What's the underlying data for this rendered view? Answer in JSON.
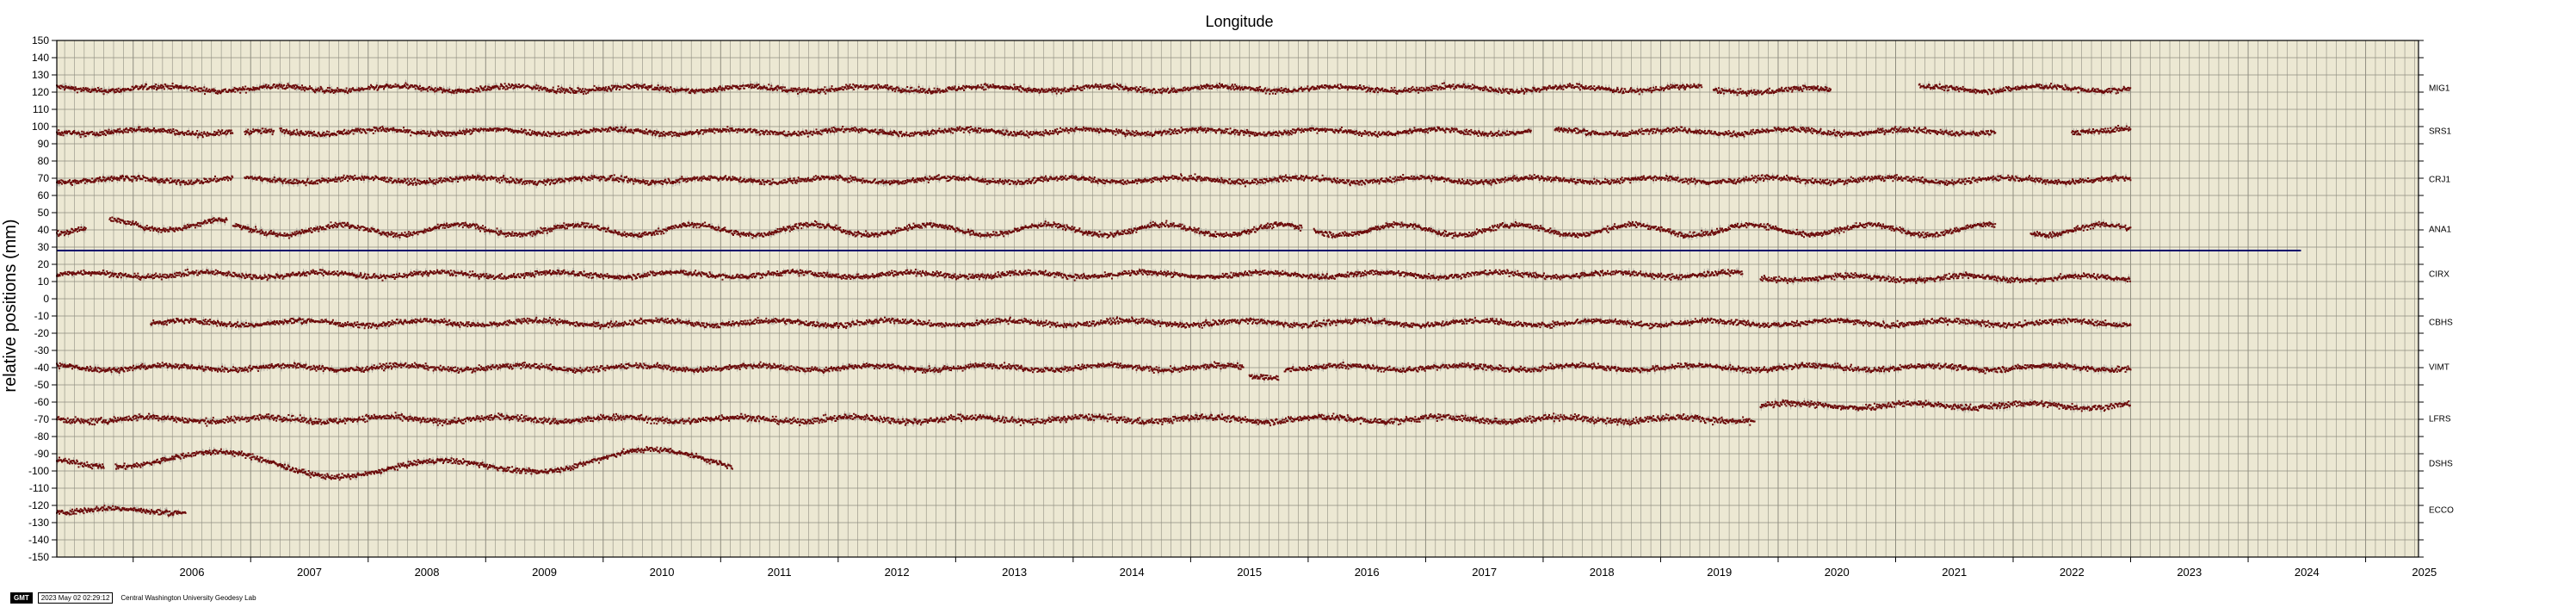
{
  "chart_data": {
    "type": "scatter",
    "title": "Longitude",
    "ylabel": "relative positions (mm)",
    "xlabel": "",
    "xlim": [
      2005.35,
      2025.45
    ],
    "ylim": [
      -150,
      150
    ],
    "y_ticks": [
      150,
      140,
      130,
      120,
      110,
      100,
      90,
      80,
      70,
      60,
      50,
      40,
      30,
      20,
      10,
      0,
      -10,
      -20,
      -30,
      -40,
      -50,
      -60,
      -70,
      -80,
      -90,
      -100,
      -110,
      -120,
      -130,
      -140,
      -150
    ],
    "x_tick_labels": [
      "2006",
      "2007",
      "2008",
      "2009",
      "2010",
      "2011",
      "2012",
      "2013",
      "2014",
      "2015",
      "2016",
      "2017",
      "2018",
      "2019",
      "2020",
      "2021",
      "2022",
      "2023",
      "2024",
      "2025"
    ],
    "grid": true,
    "series": [
      {
        "name": "MIG1",
        "offset": 122,
        "segments": [
          [
            2005.35,
            2019.35,
            0
          ],
          [
            2019.45,
            2020.45,
            -1
          ],
          [
            2021.2,
            2023.0,
            0
          ]
        ]
      },
      {
        "name": "SRS1",
        "offset": 97,
        "segments": [
          [
            2005.35,
            2006.85,
            0
          ],
          [
            2006.95,
            2007.2,
            -1
          ],
          [
            2007.25,
            2017.9,
            0
          ],
          [
            2018.1,
            2021.85,
            0
          ],
          [
            2022.5,
            2023.0,
            1
          ]
        ]
      },
      {
        "name": "CRJ1",
        "offset": 69,
        "segments": [
          [
            2005.35,
            2006.85,
            0
          ],
          [
            2006.95,
            2023.0,
            0
          ]
        ]
      },
      {
        "name": "ANA1",
        "offset": 40,
        "segments": [
          [
            2005.35,
            2005.6,
            0
          ],
          [
            2005.8,
            2006.8,
            3
          ],
          [
            2006.85,
            2015.95,
            0
          ],
          [
            2016.05,
            2021.85,
            0
          ],
          [
            2022.15,
            2023.0,
            0
          ]
        ]
      },
      {
        "name": "CIRX",
        "offset": 14,
        "segments": [
          [
            2005.35,
            2019.7,
            0
          ],
          [
            2019.85,
            2023.0,
            -2
          ]
        ]
      },
      {
        "name": "CBHS",
        "offset": -14,
        "segments": [
          [
            2006.15,
            2023.0,
            0
          ]
        ]
      },
      {
        "name": "VIMT",
        "offset": -40,
        "segments": [
          [
            2005.35,
            2015.45,
            0
          ],
          [
            2015.5,
            2015.75,
            -5
          ],
          [
            2015.8,
            2023.0,
            0
          ]
        ]
      },
      {
        "name": "LFRS",
        "offset": -70,
        "segments": [
          [
            2005.35,
            2019.8,
            0
          ],
          [
            2019.85,
            2023.0,
            8
          ]
        ]
      },
      {
        "name": "DSHS",
        "offset": -96,
        "segments": [
          [
            2005.35,
            2005.75,
            0
          ],
          [
            2005.85,
            2011.1,
            0
          ]
        ]
      },
      {
        "name": "ECCO",
        "offset": -123,
        "segments": [
          [
            2005.35,
            2006.45,
            0
          ]
        ]
      }
    ],
    "reference_line": {
      "y": 28,
      "x_start": 2005.35,
      "x_end": 2024.45,
      "color": "#00006a"
    },
    "colors": {
      "point": "#6b0a0a",
      "background": "#ece8d3",
      "grid": "#8f8d80",
      "error_bar": "#b5b3a8"
    }
  },
  "footer": {
    "logo": "GMT",
    "timestamp": "2023 May 02 02:29:12",
    "lab": "Central Washington University Geodesy Lab"
  }
}
